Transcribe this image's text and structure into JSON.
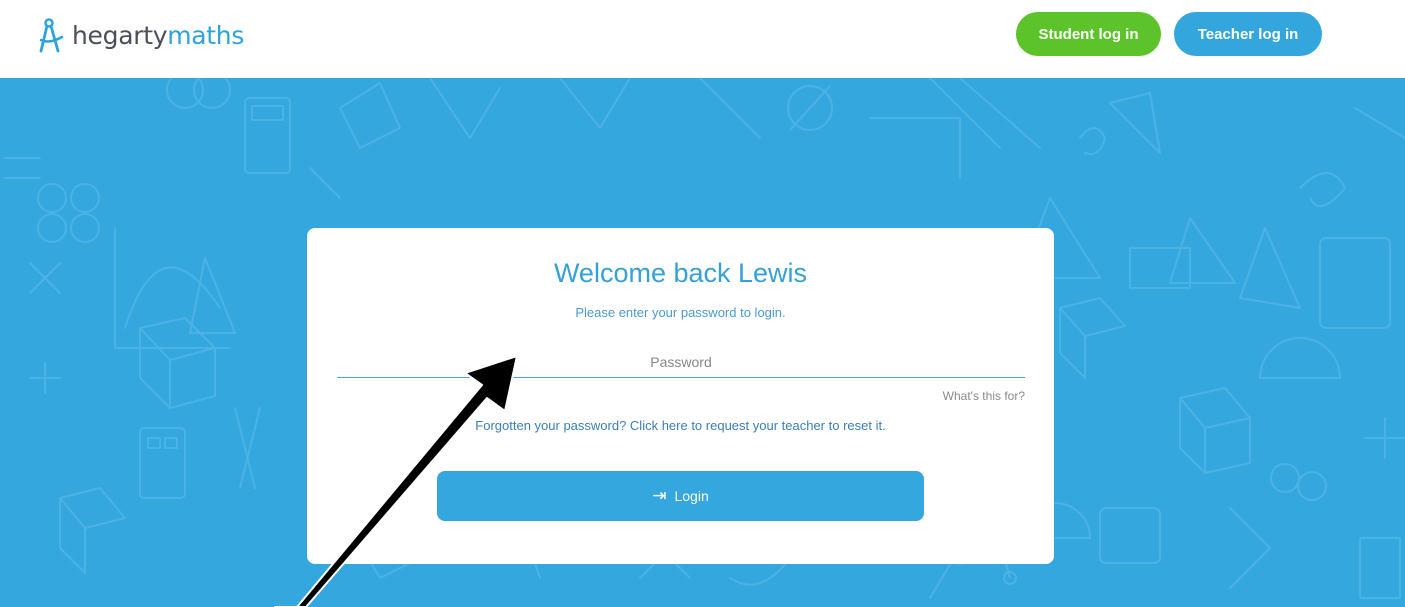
{
  "header": {
    "logo": {
      "text_part1": "hegarty",
      "text_part2": "maths",
      "icon": "compass-icon"
    },
    "student_login_label": "Student log in",
    "teacher_login_label": "Teacher log in"
  },
  "card": {
    "title": "Welcome back Lewis",
    "subtitle": "Please enter your password to login.",
    "password": {
      "placeholder": "Password",
      "value": ""
    },
    "whats_this_label": "What's this for?",
    "forgot_label": "Forgotten your password? Click here to request your teacher to reset it.",
    "login_label": "Login",
    "login_icon": "login-arrow-icon"
  },
  "colors": {
    "brand_blue": "#35a7df",
    "student_green": "#5cc32a",
    "annotation_arrow": "#000000"
  }
}
